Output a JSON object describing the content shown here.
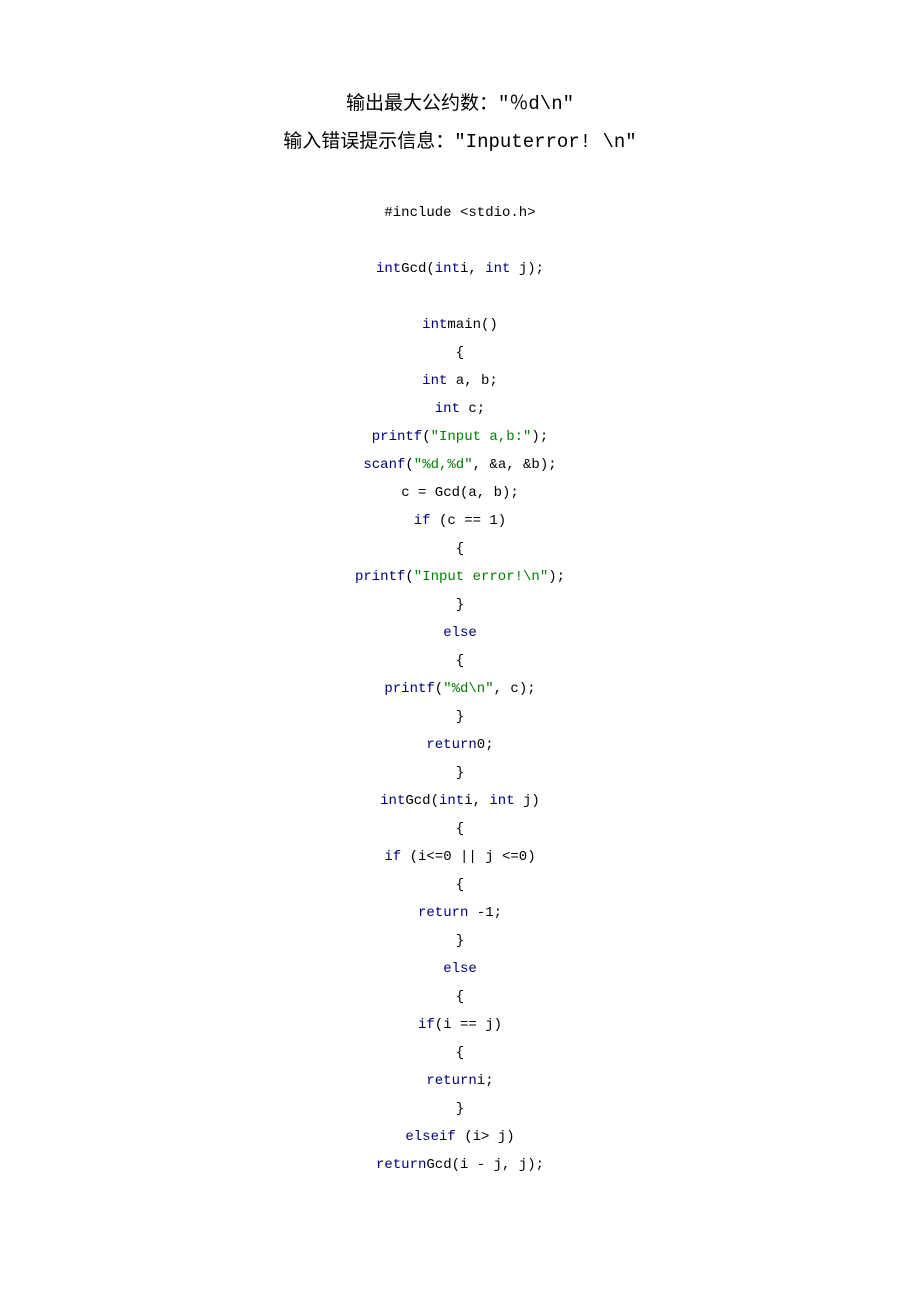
{
  "headings": {
    "line1_label": "输出最大公约数：",
    "line1_code": "\"％d\\n\"",
    "line2_label": "输入错误提示信息：",
    "line2_code": "\"Inputerror! \\n\""
  },
  "code": {
    "lines": [
      [
        {
          "cls": "plain",
          "t": "#include <stdio.h>"
        }
      ],
      [
        {
          "cls": "plain",
          "t": ""
        }
      ],
      [
        {
          "cls": "kw",
          "t": "int"
        },
        {
          "cls": "plain",
          "t": "Gcd("
        },
        {
          "cls": "kw",
          "t": "int"
        },
        {
          "cls": "plain",
          "t": "i, "
        },
        {
          "cls": "kw",
          "t": "int"
        },
        {
          "cls": "plain",
          "t": " j);"
        }
      ],
      [
        {
          "cls": "plain",
          "t": ""
        }
      ],
      [
        {
          "cls": "kw",
          "t": "int"
        },
        {
          "cls": "plain",
          "t": "main()"
        }
      ],
      [
        {
          "cls": "plain",
          "t": "{"
        }
      ],
      [
        {
          "cls": "kw",
          "t": "int"
        },
        {
          "cls": "plain",
          "t": " a, b;"
        }
      ],
      [
        {
          "cls": "kw",
          "t": "int"
        },
        {
          "cls": "plain",
          "t": " c;"
        }
      ],
      [
        {
          "cls": "kw",
          "t": "printf"
        },
        {
          "cls": "plain",
          "t": "("
        },
        {
          "cls": "str",
          "t": "\"Input a,b:\""
        },
        {
          "cls": "plain",
          "t": ");"
        }
      ],
      [
        {
          "cls": "kw",
          "t": "scanf"
        },
        {
          "cls": "plain",
          "t": "("
        },
        {
          "cls": "str",
          "t": "\"%d,%d\""
        },
        {
          "cls": "plain",
          "t": ", &a, &b);"
        }
      ],
      [
        {
          "cls": "plain",
          "t": "c = Gcd(a, b);"
        }
      ],
      [
        {
          "cls": "kw",
          "t": "if"
        },
        {
          "cls": "plain",
          "t": " (c == 1)"
        }
      ],
      [
        {
          "cls": "plain",
          "t": "{"
        }
      ],
      [
        {
          "cls": "kw",
          "t": "printf"
        },
        {
          "cls": "plain",
          "t": "("
        },
        {
          "cls": "str",
          "t": "\"Input error!\\n\""
        },
        {
          "cls": "plain",
          "t": ");"
        }
      ],
      [
        {
          "cls": "plain",
          "t": "}"
        }
      ],
      [
        {
          "cls": "kw",
          "t": "else"
        }
      ],
      [
        {
          "cls": "plain",
          "t": "{"
        }
      ],
      [
        {
          "cls": "kw",
          "t": "printf"
        },
        {
          "cls": "plain",
          "t": "("
        },
        {
          "cls": "str",
          "t": "\"%d\\n\""
        },
        {
          "cls": "plain",
          "t": ", c);"
        }
      ],
      [
        {
          "cls": "plain",
          "t": "}"
        }
      ],
      [
        {
          "cls": "kw",
          "t": "return"
        },
        {
          "cls": "plain",
          "t": "0;"
        }
      ],
      [
        {
          "cls": "plain",
          "t": "}"
        }
      ],
      [
        {
          "cls": "kw",
          "t": "int"
        },
        {
          "cls": "plain",
          "t": "Gcd("
        },
        {
          "cls": "kw",
          "t": "int"
        },
        {
          "cls": "plain",
          "t": "i, "
        },
        {
          "cls": "kw",
          "t": "int"
        },
        {
          "cls": "plain",
          "t": " j)"
        }
      ],
      [
        {
          "cls": "plain",
          "t": "{"
        }
      ],
      [
        {
          "cls": "kw",
          "t": "if"
        },
        {
          "cls": "plain",
          "t": " (i<=0 || j <=0)"
        }
      ],
      [
        {
          "cls": "plain",
          "t": "{"
        }
      ],
      [
        {
          "cls": "kw",
          "t": "return"
        },
        {
          "cls": "plain",
          "t": " -1;"
        }
      ],
      [
        {
          "cls": "plain",
          "t": "}"
        }
      ],
      [
        {
          "cls": "kw",
          "t": "else"
        }
      ],
      [
        {
          "cls": "plain",
          "t": "{"
        }
      ],
      [
        {
          "cls": "kw",
          "t": "if"
        },
        {
          "cls": "plain",
          "t": "(i == j)"
        }
      ],
      [
        {
          "cls": "plain",
          "t": "{"
        }
      ],
      [
        {
          "cls": "kw",
          "t": "return"
        },
        {
          "cls": "plain",
          "t": "i;"
        }
      ],
      [
        {
          "cls": "plain",
          "t": "}"
        }
      ],
      [
        {
          "cls": "kw",
          "t": "else"
        },
        {
          "cls": "kw",
          "t": "if"
        },
        {
          "cls": "plain",
          "t": " (i> j)"
        }
      ],
      [
        {
          "cls": "kw",
          "t": "return"
        },
        {
          "cls": "plain",
          "t": "Gcd(i - j, j);"
        }
      ]
    ]
  }
}
